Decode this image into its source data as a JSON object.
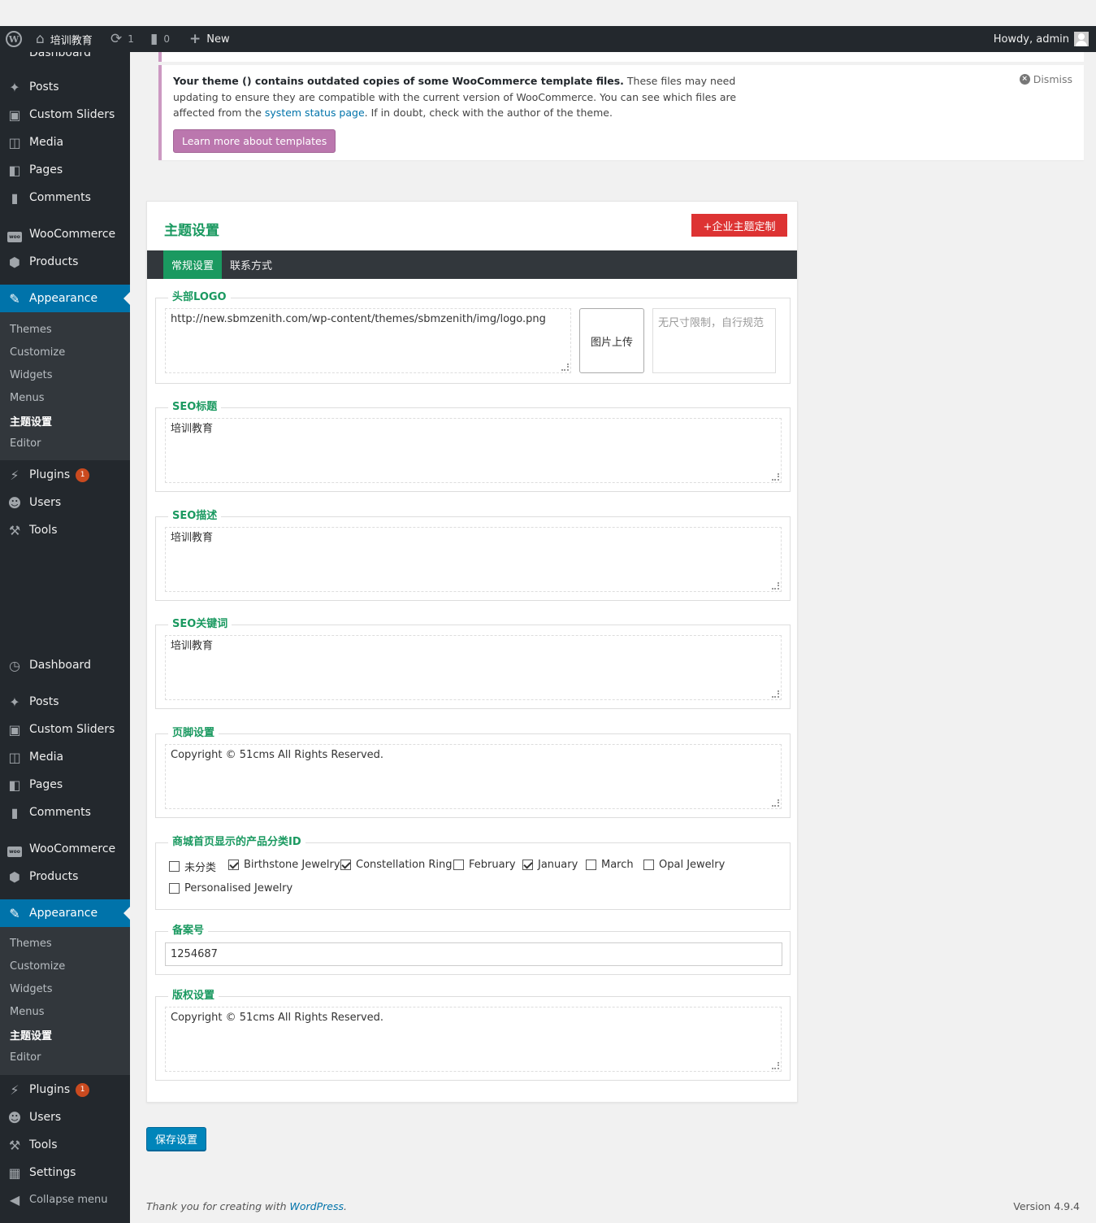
{
  "admin_bar": {
    "site_name": "培训教育",
    "updates_count": "1",
    "comments_count": "0",
    "new_label": "New",
    "greeting": "Howdy, admin"
  },
  "sidebar": {
    "cut_top_item": "Dashboard",
    "menu_a": [
      "Posts",
      "Custom Sliders",
      "Media",
      "Pages",
      "Comments",
      "WooCommerce",
      "Products",
      "Appearance"
    ],
    "sub_a": [
      "Themes",
      "Customize",
      "Widgets",
      "Menus",
      "主题设置",
      "Editor"
    ],
    "menu_a2": [
      "Plugins",
      "Users",
      "Tools"
    ],
    "plugins_badge": "1",
    "menu_b": [
      "Dashboard",
      "Posts",
      "Custom Sliders",
      "Media",
      "Pages",
      "Comments",
      "WooCommerce",
      "Products",
      "Appearance"
    ],
    "sub_b": [
      "Themes",
      "Customize",
      "Widgets",
      "Menus",
      "主题设置",
      "Editor"
    ],
    "menu_b2": [
      "Plugins",
      "Users",
      "Tools",
      "Settings",
      "Collapse menu"
    ]
  },
  "notice": {
    "bold_text": "Your theme () contains outdated copies of some WooCommerce template files.",
    "text_1": " These files may need updating to ensure they are compatible with the current version of WooCommerce. You can see which files are affected from the ",
    "link_text": "system status page",
    "text_2": ". If in doubt, check with the author of the theme.",
    "button_label": "Learn more about templates",
    "dismiss_label": "Dismiss"
  },
  "panel": {
    "title": "主题设置",
    "custom_button": "+企业主题定制",
    "tabs": [
      "常规设置",
      "联系方式"
    ],
    "logo": {
      "legend": "头部LOGO",
      "value": "http://new.sbmzenith.com/wp-content/themes/sbmzenith/img/logo.png",
      "upload_label": "图片上传",
      "preview_hint": "无尺寸限制，自行规范"
    },
    "seo_title": {
      "legend": "SEO标题",
      "value": "培训教育"
    },
    "seo_desc": {
      "legend": "SEO描述",
      "value": "培训教育"
    },
    "seo_keywords": {
      "legend": "SEO关键词",
      "value": "培训教育"
    },
    "footer": {
      "legend": "页脚设置",
      "value": "Copyright © 51cms All Rights Reserved."
    },
    "categories": {
      "legend": "商城首页显示的产品分类ID",
      "items": [
        {
          "label": "未分类",
          "checked": false
        },
        {
          "label": "Birthstone Jewelry",
          "checked": true
        },
        {
          "label": "Constellation Ring",
          "checked": true
        },
        {
          "label": "February",
          "checked": false
        },
        {
          "label": "January",
          "checked": true
        },
        {
          "label": "March",
          "checked": false
        },
        {
          "label": "Opal Jewelry",
          "checked": false
        },
        {
          "label": "Personalised Jewelry",
          "checked": false
        }
      ]
    },
    "icp": {
      "legend": "备案号",
      "value": "1254687"
    },
    "copyright": {
      "legend": "版权设置",
      "value": "Copyright © 51cms All Rights Reserved."
    }
  },
  "save_button": "保存设置",
  "footer": {
    "thanks_text": "Thank you for creating with ",
    "wp_link": "WordPress",
    "thanks_end": ".",
    "version": "Version 4.9.4"
  },
  "colors": {
    "adminbar": "#23282d",
    "sidebar_current": "#0073aa",
    "accent_green": "#1a9960",
    "custom_button": "#dd3333",
    "woo_purple": "#bb77ae",
    "save_button": "#0085ba"
  }
}
